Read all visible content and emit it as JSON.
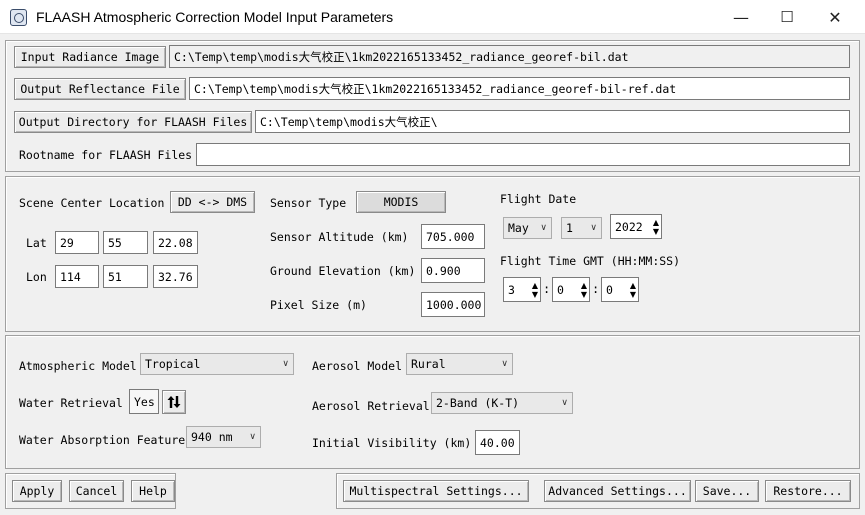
{
  "window": {
    "title": "FLAASH Atmospheric Correction Model Input Parameters",
    "minimize_glyph": "—",
    "maximize_glyph": "☐",
    "close_glyph": "✕"
  },
  "files": {
    "input_radiance_button": "Input Radiance Image",
    "input_radiance_path": "C:\\Temp\\temp\\modis大气校正\\1km2022165133452_radiance_georef-bil.dat",
    "output_reflectance_button": "Output Reflectance File",
    "output_reflectance_path": "C:\\Temp\\temp\\modis大气校正\\1km2022165133452_radiance_georef-bil-ref.dat",
    "output_directory_button": "Output Directory for FLAASH Files",
    "output_directory_path": "C:\\Temp\\temp\\modis大气校正\\",
    "rootname_label": "Rootname for FLAASH Files",
    "rootname_value": ""
  },
  "scene": {
    "center_location_label": "Scene Center Location",
    "dd_dms_button": "DD <-> DMS",
    "lat_label": "Lat",
    "lat": [
      "29",
      "55",
      "22.08"
    ],
    "lon_label": "Lon",
    "lon": [
      "114",
      "51",
      "32.76"
    ]
  },
  "sensor": {
    "type_label": "Sensor Type",
    "type_value": "MODIS",
    "altitude_label": "Sensor Altitude (km)",
    "altitude_value": "705.000",
    "ground_elevation_label": "Ground Elevation (km)",
    "ground_elevation_value": "0.900",
    "pixel_size_label": "Pixel Size (m)",
    "pixel_size_value": "1000.000"
  },
  "flight": {
    "date_label": "Flight Date",
    "month": "May",
    "day": "1",
    "year": "2022",
    "time_label": "Flight Time GMT (HH:MM:SS)",
    "hh": "3",
    "mm": "0",
    "ss": "0",
    "separator": ":"
  },
  "model": {
    "atmospheric_label": "Atmospheric Model",
    "atmospheric_value": "Tropical",
    "water_retrieval_label": "Water Retrieval",
    "water_retrieval_value": "Yes",
    "water_absorption_label": "Water Absorption Feature",
    "water_absorption_value": "940 nm",
    "aerosol_model_label": "Aerosol Model",
    "aerosol_model_value": "Rural",
    "aerosol_retrieval_label": "Aerosol Retrieval",
    "aerosol_retrieval_value": "2-Band (K-T)",
    "initial_visibility_label": "Initial Visibility (km)",
    "initial_visibility_value": "40.00"
  },
  "buttons": {
    "apply": "Apply",
    "cancel": "Cancel",
    "help": "Help",
    "multispectral": "Multispectral Settings...",
    "advanced": "Advanced Settings...",
    "save": "Save...",
    "restore": "Restore..."
  },
  "icons": {
    "app": "flaash-app-icon",
    "toggle": "swap-arrows-icon",
    "dropdown": "chevron-down-icon",
    "spinner": "spin-arrows-icon"
  }
}
